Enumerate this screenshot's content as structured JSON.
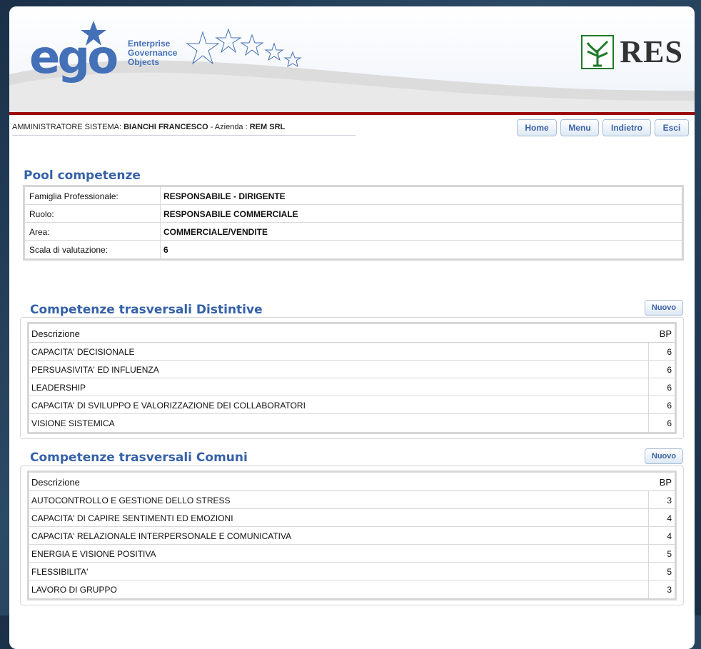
{
  "header": {
    "logo_text": "ego",
    "logo_tagline": [
      "Enterprise",
      "Governance",
      "Objects"
    ],
    "partner_logo_text": "RES"
  },
  "userbar": {
    "role": "AMMINISTRATORE SISTEMA:",
    "user": "BIANCHI FRANCESCO",
    "company_label": "- Azienda :",
    "company": "REM SRL"
  },
  "nav": {
    "home": "Home",
    "menu": "Menu",
    "back": "Indietro",
    "exit": "Esci"
  },
  "pool": {
    "title": "Pool competenze",
    "rows": [
      {
        "label": "Famiglia Professionale:",
        "value": "RESPONSABILE - DIRIGENTE"
      },
      {
        "label": "Ruolo:",
        "value": "RESPONSABILE COMMERCIALE"
      },
      {
        "label": "Area:",
        "value": "COMMERCIALE/VENDITE"
      },
      {
        "label": "Scala di valutazione:",
        "value": "6"
      }
    ]
  },
  "distintive": {
    "title": "Competenze trasversali Distintive",
    "new_label": "Nuovo",
    "col_desc": "Descrizione",
    "col_bp": "BP",
    "rows": [
      {
        "desc": "CAPACITA' DECISIONALE",
        "bp": "6"
      },
      {
        "desc": "PERSUASIVITA' ED INFLUENZA",
        "bp": "6"
      },
      {
        "desc": "LEADERSHIP",
        "bp": "6"
      },
      {
        "desc": "CAPACITA' DI SVILUPPO E VALORIZZAZIONE DEI COLLABORATORI",
        "bp": "6"
      },
      {
        "desc": "VISIONE SISTEMICA",
        "bp": "6"
      }
    ]
  },
  "comuni": {
    "title": "Competenze trasversali Comuni",
    "new_label": "Nuovo",
    "col_desc": "Descrizione",
    "col_bp": "BP",
    "rows": [
      {
        "desc": "AUTOCONTROLLO E GESTIONE DELLO STRESS",
        "bp": "3"
      },
      {
        "desc": "CAPACITA' DI CAPIRE SENTIMENTI ED EMOZIONI",
        "bp": "4"
      },
      {
        "desc": "CAPACITA' RELAZIONALE INTERPERSONALE E COMUNICATIVA",
        "bp": "4"
      },
      {
        "desc": "ENERGIA E VISIONE POSITIVA",
        "bp": "5"
      },
      {
        "desc": "FLESSIBILITA'",
        "bp": "5"
      },
      {
        "desc": "LAVORO DI GRUPPO",
        "bp": "3"
      }
    ]
  },
  "colors": {
    "accent": "#3561a8",
    "header_rule": "#9b0b0b"
  }
}
